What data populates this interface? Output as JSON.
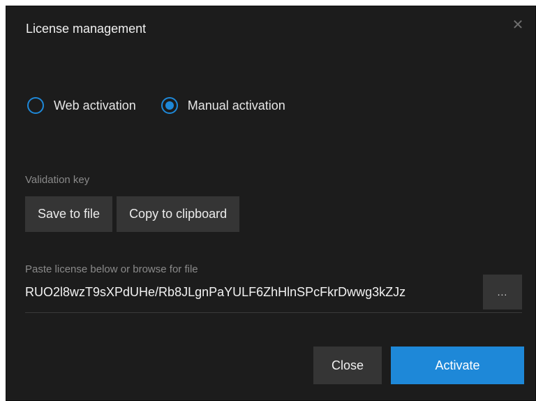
{
  "dialog": {
    "title": "License management",
    "close_icon": "close-icon"
  },
  "activation": {
    "options": [
      {
        "label": "Web activation",
        "selected": false
      },
      {
        "label": "Manual activation",
        "selected": true
      }
    ],
    "accent_color": "#1e88d8"
  },
  "validation": {
    "label": "Validation key",
    "save_label": "Save to file",
    "copy_label": "Copy to clipboard"
  },
  "license": {
    "label": "Paste license below or browse for file",
    "value": "RUO2l8wzT9sXPdUHe/Rb8JLgnPaYULF6ZhHlnSPcFkrDwwg3kZJz",
    "browse_label": "..."
  },
  "footer": {
    "close_label": "Close",
    "activate_label": "Activate"
  }
}
